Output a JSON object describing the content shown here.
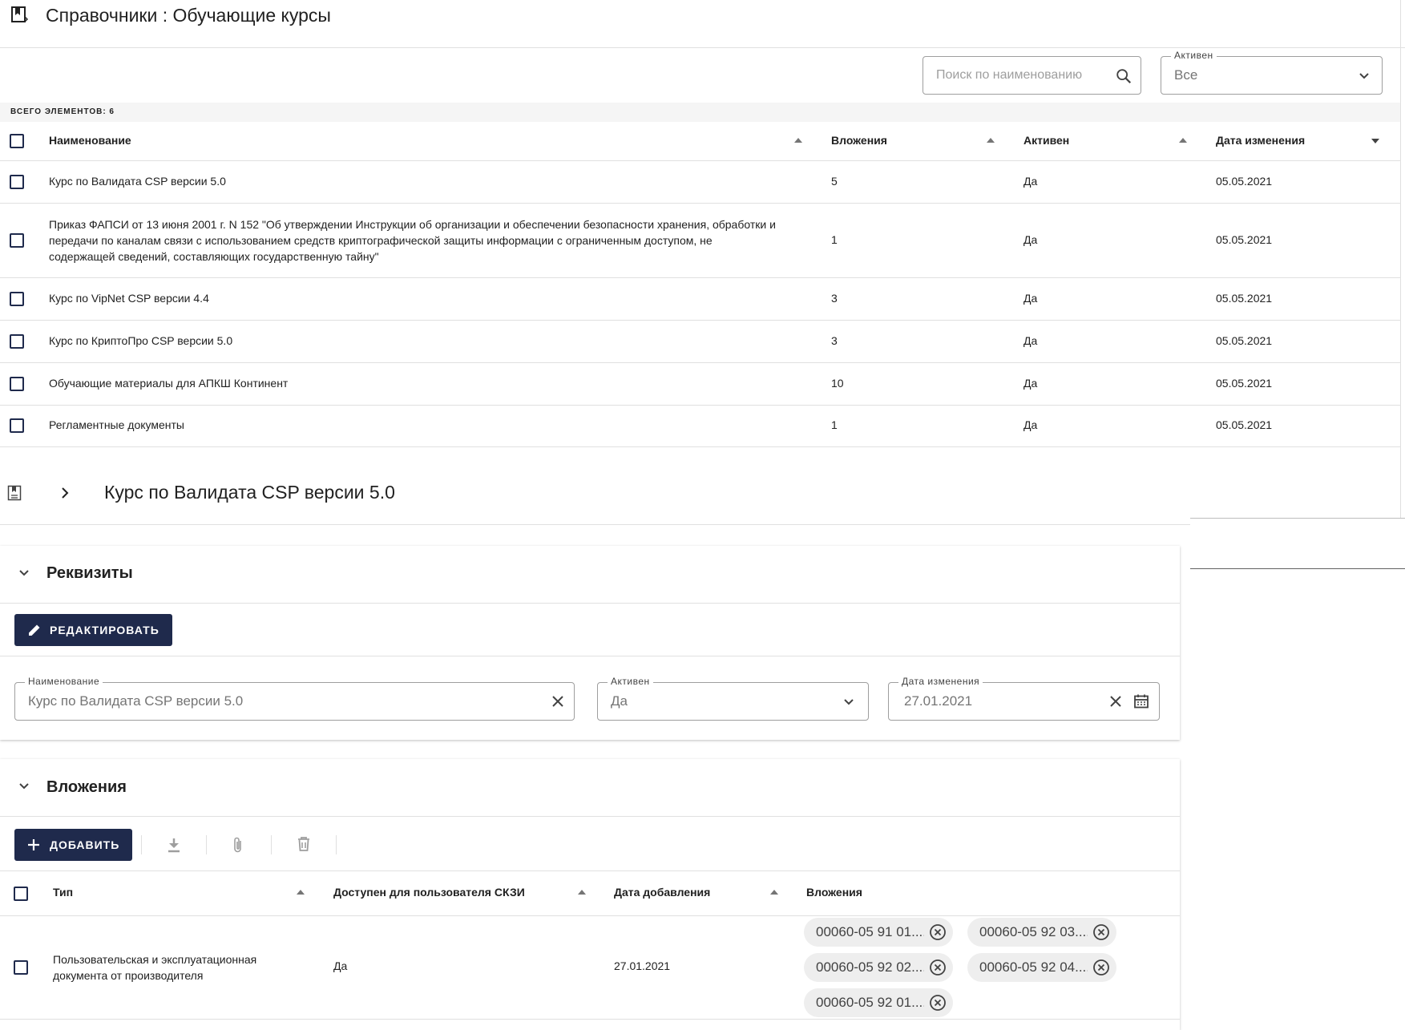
{
  "header": {
    "title": "Справочники : Обучающие курсы"
  },
  "filters": {
    "search_placeholder": "Поиск по наименованию",
    "active_label": "Активен",
    "active_value": "Все"
  },
  "list": {
    "total": "ВСЕГО ЭЛЕМЕНТОВ: 6",
    "columns": [
      "Наименование",
      "Вложения",
      "Активен",
      "Дата изменения"
    ],
    "rows": [
      {
        "name": "Курс по Валидата CSP версии 5.0",
        "attachments": "5",
        "active": "Да",
        "date": "05.05.2021"
      },
      {
        "name_lines": [
          "Приказ ФАПСИ от 13 июня 2001 г. N 152 \"Об утверждении Инструкции об организации и обеспечении безопасности хранения, обработки и",
          "передачи по каналам связи с использованием средств криптографической защиты информации с ограниченным доступом, не",
          "содержащей сведений, составляющих государственную тайну\""
        ],
        "attachments": "1",
        "active": "Да",
        "date": "05.05.2021"
      },
      {
        "name": "Курс по VipNet CSP версии 4.4",
        "attachments": "3",
        "active": "Да",
        "date": "05.05.2021"
      },
      {
        "name": "Курс по КриптоПро CSP версии 5.0",
        "attachments": "3",
        "active": "Да",
        "date": "05.05.2021"
      },
      {
        "name": "Обучающие материалы для АПКШ Континент",
        "attachments": "10",
        "active": "Да",
        "date": "05.05.2021"
      },
      {
        "name": "Регламентные документы",
        "attachments": "1",
        "active": "Да",
        "date": "05.05.2021"
      }
    ]
  },
  "detail": {
    "title": "Курс по Валидата CSP версии 5.0",
    "requisites": {
      "section_title": "Реквизиты",
      "edit_button": "РЕДАКТИРОВАТЬ",
      "name_label": "Наименование",
      "name_value": "Курс по Валидата CSP версии 5.0",
      "active_label": "Активен",
      "active_value": "Да",
      "date_label": "Дата изменения",
      "date_value": "27.01.2021"
    },
    "attachments": {
      "section_title": "Вложения",
      "add_button": "ДОБАВИТЬ",
      "columns": [
        "Тип",
        "Доступен для пользователя СКЗИ",
        "Дата добавления",
        "Вложения"
      ],
      "row": {
        "type_lines": [
          "Пользовательская и эксплуатационная",
          "документа от производителя"
        ],
        "available": "Да",
        "date": "27.01.2021",
        "files": [
          "00060-05 91 01....",
          "00060-05 92 03....",
          "00060-05 92 02....",
          "00060-05 92 04....",
          "00060-05 92 01...."
        ]
      }
    }
  },
  "icons": [
    "bookmark-icon",
    "search-icon",
    "chevron-down-icon",
    "chevron-right-icon",
    "pencil-icon",
    "close-icon",
    "calendar-icon",
    "plus-icon",
    "download-icon",
    "paperclip-icon",
    "trash-icon",
    "circle-close-icon"
  ],
  "colors": {
    "primary": "#1f2a4c",
    "border": "#e0e0e0"
  }
}
